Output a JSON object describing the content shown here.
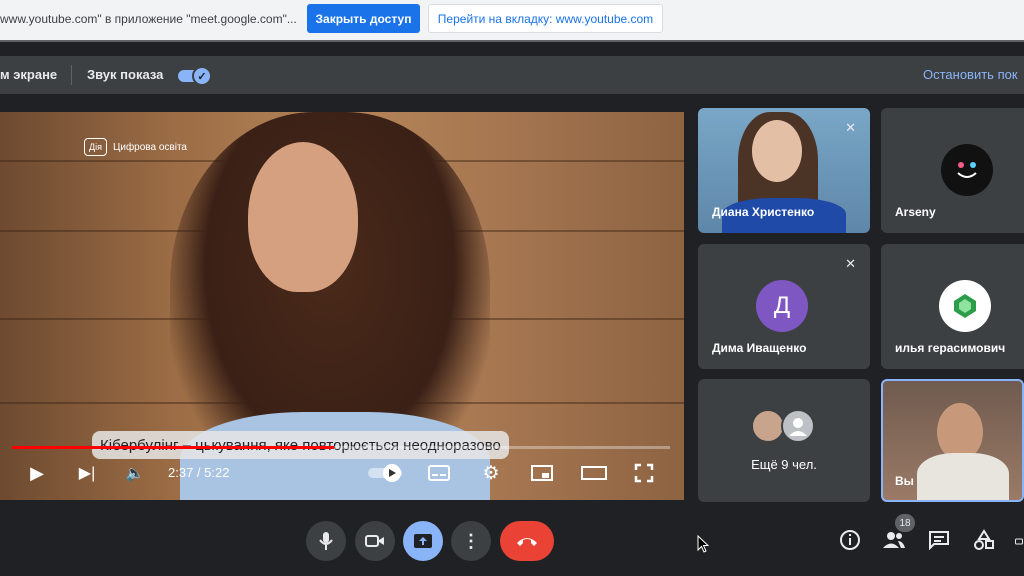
{
  "share_bar": {
    "message": "www.youtube.com\" в приложение \"meet.google.com\"...",
    "stop_button": "Закрыть доступ",
    "goto_button": "Перейти на вкладку: www.youtube.com"
  },
  "presentation_bar": {
    "screen_label": "м экране",
    "audio_label": "Звук показа",
    "audio_enabled": true,
    "stop_link": "Остановить пок"
  },
  "video": {
    "watermark_badge": "Дія",
    "watermark_text": "Цифрова освіта",
    "subtitle": "Кібербулінг – цькування, яке повторюється неодноразово",
    "current_time": "2:37",
    "duration": "5:22",
    "time_display": "2:37 / 5:22",
    "progress_fraction": 0.49
  },
  "participants": [
    {
      "name": "Диана Христенко",
      "muted": true
    },
    {
      "name": "Arseny",
      "muted": false
    },
    {
      "name": "Дима Иващенко",
      "muted": true,
      "initial": "Д"
    },
    {
      "name": "илья герасимович",
      "muted": false
    },
    {
      "name": "Ещё 9 чел.",
      "muted": false
    },
    {
      "name": "Вы",
      "muted": false
    }
  ],
  "people_count": "18",
  "colors": {
    "accent_blue": "#1a73e8",
    "end_call_red": "#ea4335",
    "avatar_purple": "#7e57c2",
    "self_tile_border": "#8ab4f8"
  },
  "icons": [
    "mic-icon",
    "camera-icon",
    "present-icon",
    "more-icon",
    "end-call-icon",
    "info-icon",
    "people-icon",
    "chat-icon",
    "activities-icon"
  ]
}
